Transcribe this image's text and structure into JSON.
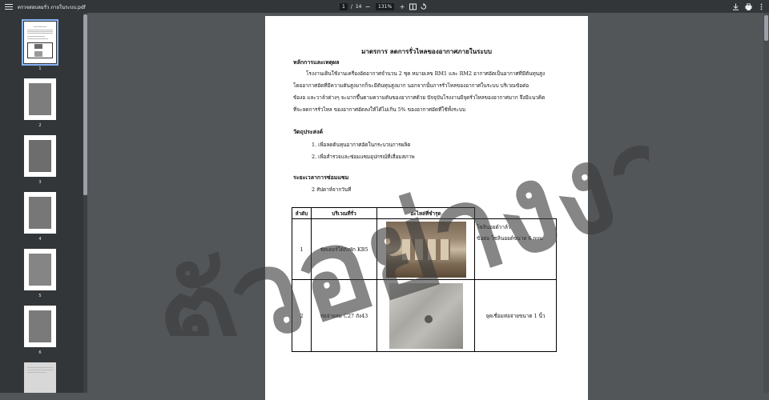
{
  "toolbar": {
    "filename": "ตรวจสอบลมรั่ว ภายในระบบ.pdf",
    "page_current": "1",
    "page_separator": "/",
    "page_total": "14",
    "zoom": "131%",
    "zoom_out": "−",
    "zoom_in": "+"
  },
  "thumbnails": [
    {
      "num": "1"
    },
    {
      "num": "2"
    },
    {
      "num": "3"
    },
    {
      "num": "4"
    },
    {
      "num": "5"
    },
    {
      "num": "6"
    }
  ],
  "document": {
    "title": "มาตรการ ลดการรั่วไหลของอากาศภายในระบบ",
    "section_principle": "หลักการและเหตุผล",
    "principle_lines": [
      "โรงงานเดินใช้งานเครื่องอัดอากาศจำนวน 2 ชุด หมายเลข RM1 และ RM2 อากาศอัดเป็นอากาศที่มีต้นทุนสูง",
      "โดยอากาศอัดที่มีความดันสูงมากก็จะมีต้นทุนสูงมาก นอกจากนั้นการรั่วไหลของอากาศในระบบ บริเวณข้อต่อ",
      "ข้องอ และวาล์วต่างๆ จะมากขึ้นตามความดันของอากาศด้วย ปัจจุบันโรงงานมีจุดรั่วไหลของอากาศมาก จึงมีแนวคิด",
      "ที่จะลดการรั่วไหล ของอากาศอัดลงให้ได้ไม่เกิน 5% ของอากาศอัดที่ใช้ทั้งระบบ"
    ],
    "section_objective": "วัตถุประสงค์",
    "objectives": [
      "1. เพื่อลดต้นทุนอากาศอัดในกระบวนการผลิต",
      "2. เพื่อสำรวจและซ่อมแซมอุปกรณ์ที่เสื่อมสภาพ"
    ],
    "section_period": "ระยะเวลาการซ่อมแซม",
    "period_line": "2 สัปดาห์จากวันที่",
    "table": {
      "headers": [
        "ลำดับ",
        "บริเวณที่รั่ว",
        "อะไหล่ที่ชำรุด"
      ],
      "rows": [
        {
          "no": "1",
          "location": "ชัตเตอร์ใต้ถังพัก KB5",
          "part_line1": "โซลินอยด์วาล์ว",
          "part_line2": "ข้อต่อ โซลินอยด์ขนาด 6 mm"
        },
        {
          "no": "2",
          "location": "ท่อจ่ายลม C27 ถัง43",
          "part_line1": "จุดเชื่อมท่อจ่ายขนาด 1 นิ้ว",
          "part_line2": ""
        }
      ]
    },
    "watermark": "ตัวอย่างงาน"
  }
}
